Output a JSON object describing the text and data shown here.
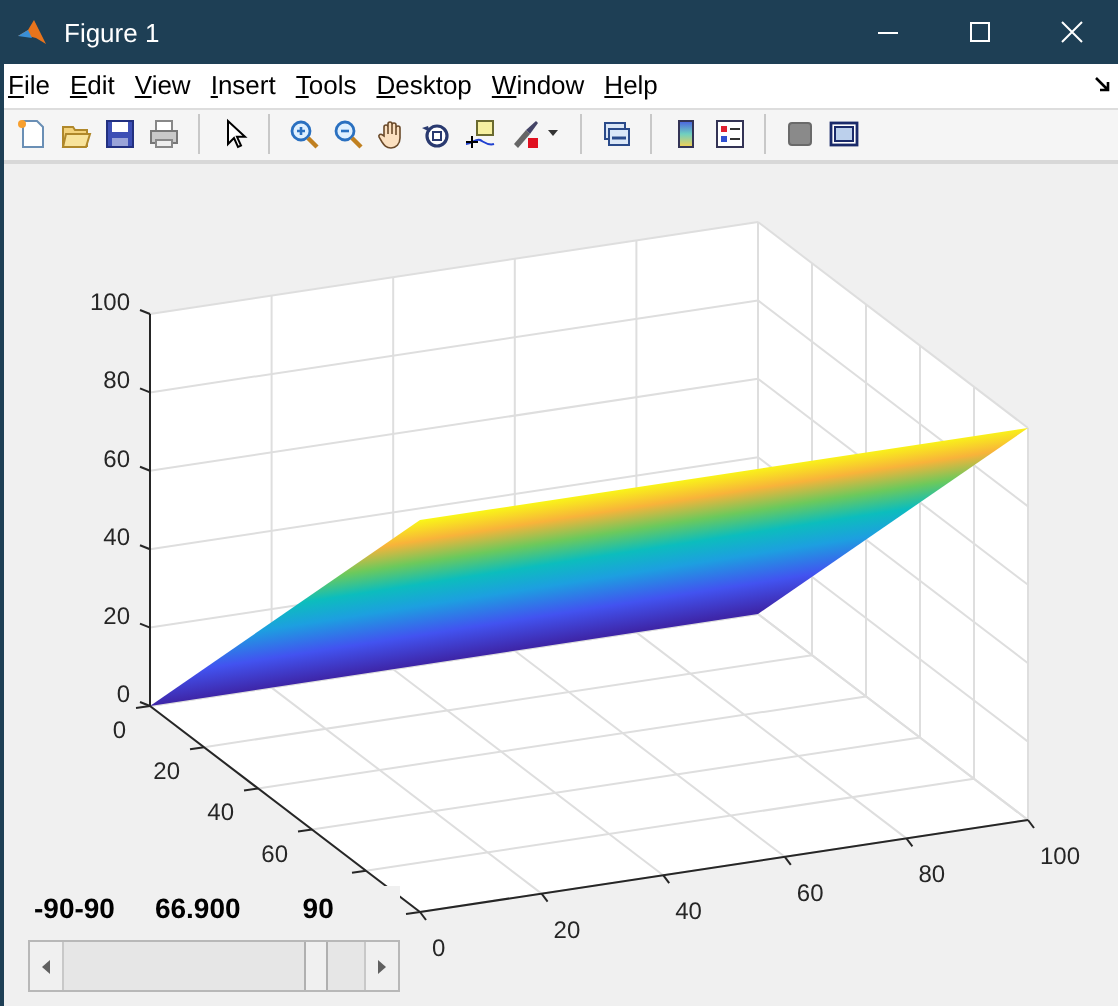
{
  "window": {
    "title": "Figure 1"
  },
  "menu": [
    {
      "label": "File"
    },
    {
      "label": "Edit"
    },
    {
      "label": "View"
    },
    {
      "label": "Insert"
    },
    {
      "label": "Tools"
    },
    {
      "label": "Desktop"
    },
    {
      "label": "Window"
    },
    {
      "label": "Help"
    }
  ],
  "axes": {
    "z_ticks": [
      "100",
      "80",
      "60",
      "40",
      "20",
      "0"
    ],
    "y_ticks": [
      "0",
      "20",
      "40",
      "60"
    ],
    "x_ticks": [
      "0",
      "20",
      "40",
      "60",
      "80",
      "100"
    ]
  },
  "slider": {
    "range_label": "-90-90",
    "value": "66.900",
    "max_label": "90",
    "level": 0.87
  }
}
